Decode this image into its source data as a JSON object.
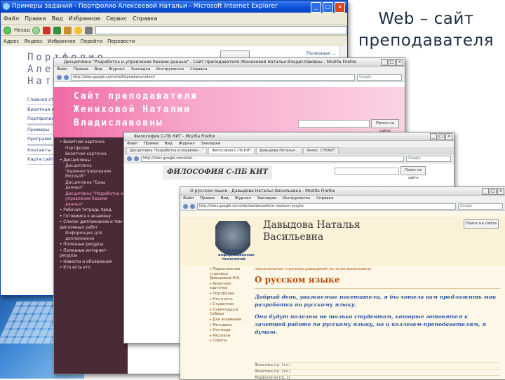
{
  "slide": {
    "title_line1": "Web – сайт",
    "title_line2": "преподавателя"
  },
  "ie_window": {
    "title": "Примеры заданий - Портфолио Алексеевой Натальи - Microsoft Internet Explorer",
    "menu_items": [
      "Файл",
      "Правка",
      "Вид",
      "Избранное",
      "Сервис",
      "Справка"
    ],
    "back_label": "Назад",
    "address_label": "Адрес",
    "toolbar_labels": [
      "Яндекс",
      "Избранное",
      "Перейти"
    ],
    "translate_label": "Перевести",
    "site_title_line1": "Портфолио",
    "site_title_line2": "Алексеевой",
    "site_title_line3": "Натальи",
    "top_right_text": "Полезные ...",
    "nav_items": [
      "Главная стр",
      "Визитная кар",
      "Портфолио",
      "",
      "",
      "Примеры",
      "Программ",
      "",
      "",
      "Контакты",
      "Карта сайт"
    ]
  },
  "pink_window": {
    "title": "Дисциплина \"Разработка и управление базами данных\" - Сайт преподавателя Жениховой Натальи Владиславовны - Mozilla Firefox",
    "menu_items": [
      "Файл",
      "Правка",
      "Вид",
      "Журнал",
      "Закладки",
      "Инструменты",
      "Справка"
    ],
    "url": "http://sites.google.com/site/hbpradunsavolom/",
    "search_placeholder": "Google",
    "header_line1": "Сайт преподавателя",
    "header_line2": "Жениховой Наталии",
    "header_line3": "Владиславовны",
    "search_button": "Поиск на сайте",
    "sidebar_items": [
      {
        "text": "Визитная карточка",
        "style": "main"
      },
      {
        "text": "Портфолио",
        "style": "sub"
      },
      {
        "text": "Визитная карточка",
        "style": "sub"
      },
      {
        "text": "Дисциплины",
        "style": "main"
      },
      {
        "text": "Дисциплина \"Администрирование Microsoft\"",
        "style": "sub"
      },
      {
        "text": "Дисциплина \"Базы данных\"",
        "style": "sub"
      },
      {
        "text": "Дисциплина \"Разработка и управление базами данных\"",
        "style": "pink"
      },
      {
        "text": "Рабочая тетрадь пред.",
        "style": "main"
      },
      {
        "text": "Готовимся к экзамену",
        "style": "main"
      },
      {
        "text": "Список дипломников и тем дипломных работ",
        "style": "main"
      },
      {
        "text": "Информация для дипломников",
        "style": "sub"
      },
      {
        "text": "Полезные ресурсы",
        "style": "main"
      },
      {
        "text": "Полезные интернет-ресурсы",
        "style": "main"
      },
      {
        "text": "Новости и объявления",
        "style": "main"
      },
      {
        "text": "Кто есть кто",
        "style": "main"
      }
    ]
  },
  "phil_window": {
    "title": "Философия С-ПБ КИТ - Mozilla Firefox",
    "tabs": [
      "Дисциплина \"Разработка и управлен...\"",
      "Философия С-ПБ КИТ",
      "Давыдова Наталья...",
      "Филос. СПБКИТ"
    ],
    "url": "http://sites.google.com/site/...",
    "header": "ФИЛОСОФИЯ С-ПБ КИТ",
    "search_button": "Поиск на сайте"
  },
  "dv_window": {
    "title": "О русском языке - Давыдова Наталья Васильевна - Mozilla Firefox",
    "url": "http://sites.google.com/site/davidovasite/o-russkom-yazyke",
    "name_line1": "Давыдова Наталья",
    "name_line2": "Васильевна",
    "logo_text": "КОЛЛЕДЖ информационных технологий",
    "search_button": "Поиск на сайте",
    "sidebar": [
      "Персональная страница Давыдовой Н.В.",
      "Визитная карточка",
      "Портфолио",
      "Кто я есть",
      "Студентам",
      "Олимпиада в Сибири",
      "Для экзаменов",
      "Методика",
      "Эта мода",
      "Рассказы",
      "Советы"
    ],
    "breadcrumb": "персональная страница давыдовой наталии васильевны",
    "heading": "О русском языке",
    "paragraph1": "Добрый день, уважаемые посетители, я бы хотела вам предложить мои разработки по русскому языку.",
    "paragraph2": "Они будут полезны не только студентам, которые готовятся к зачетной работе по русскому языку, но и коллегам-преподавателям, я думаю.",
    "file_rows": [
      "Фонетика (гр. 1гл.)",
      "Фонетика (гр. 2гл.)",
      "Морфология (гр. 1)"
    ]
  },
  "colors": {
    "pink_header": "#f06aa6",
    "sidebar_dark": "#4a2a36",
    "ie_titlebar": "#0a4fd6",
    "dv_heading": "#b84c0a",
    "dv_text": "#2a55a3"
  }
}
